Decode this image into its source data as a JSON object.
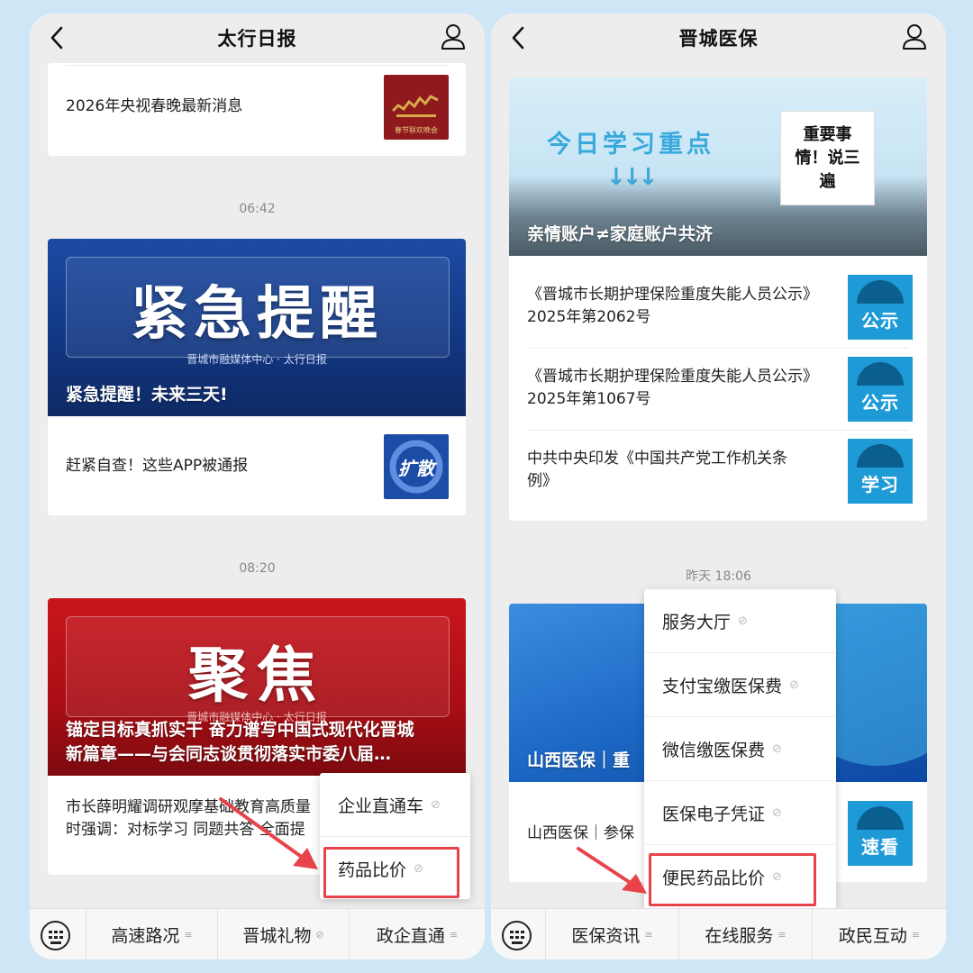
{
  "left": {
    "title": "太行日报",
    "card1": {
      "text": "2026年央视春晚最新消息",
      "thumb_caption": "春节联欢晚会"
    },
    "time1": "06:42",
    "card2": {
      "banner_big": "紧急提醒",
      "banner_sub": "晋城市融媒体中心 · 太行日报",
      "banner_caption": "紧急提醒！未来三天!",
      "row_text": "赶紧自查！这些APP被通报",
      "thumb_label": "扩散"
    },
    "time2": "08:20",
    "card3": {
      "banner_big": "聚焦",
      "banner_sub": "晋城市融媒体中心 · 太行日报",
      "banner_caption_1": "锚定目标真抓实干 奋力谱写中国式现代化晋城",
      "banner_caption_2": "新篇章——与会同志谈贯彻落实市委八届…",
      "row_text_1": "市长薛明耀调研观摩基础教育高质量",
      "row_text_2": "时强调：对标学习 同题共答 全面提"
    },
    "popup": [
      "企业直通车",
      "药品比价"
    ],
    "menu": [
      "高速路况",
      "晋城礼物",
      "政企直通"
    ]
  },
  "right": {
    "title": "晋城医保",
    "card1": {
      "banner_title": "今日学习重点",
      "banner_arrows": "↓↓↓",
      "sticker": "重要事情！说三遍",
      "banner_caption": "亲情账户≠家庭账户共济",
      "rows": [
        {
          "line1": "《晋城市长期护理保险重度失能人员公示》",
          "line2": "2025年第2062号",
          "stamp": "公示"
        },
        {
          "line1": "《晋城市长期护理保险重度失能人员公示》",
          "line2": "2025年第1067号",
          "stamp": "公示"
        },
        {
          "line1": "中共中央印发《中国共产党工作机关条",
          "line2": "例》",
          "stamp": "学习"
        }
      ]
    },
    "time1": "昨天 18:06",
    "card2": {
      "banner_caption": "山西医保｜重",
      "row_text": "山西医保｜参保",
      "stamp": "速看"
    },
    "popup": [
      "服务大厅",
      "支付宝缴医保费",
      "微信缴医保费",
      "医保电子凭证",
      "便民药品比价"
    ],
    "menu": [
      "医保资讯",
      "在线服务",
      "政民互动"
    ]
  },
  "colors": {
    "highlight": "#e8434b",
    "accent_blue": "#1e9bd7",
    "background": "#cfe6f7"
  },
  "icons": {
    "back": "chevron-left-icon",
    "user": "user-icon",
    "keyboard": "keyboard-icon",
    "link": "link-icon",
    "menu_mark": "menu-lines-icon"
  }
}
